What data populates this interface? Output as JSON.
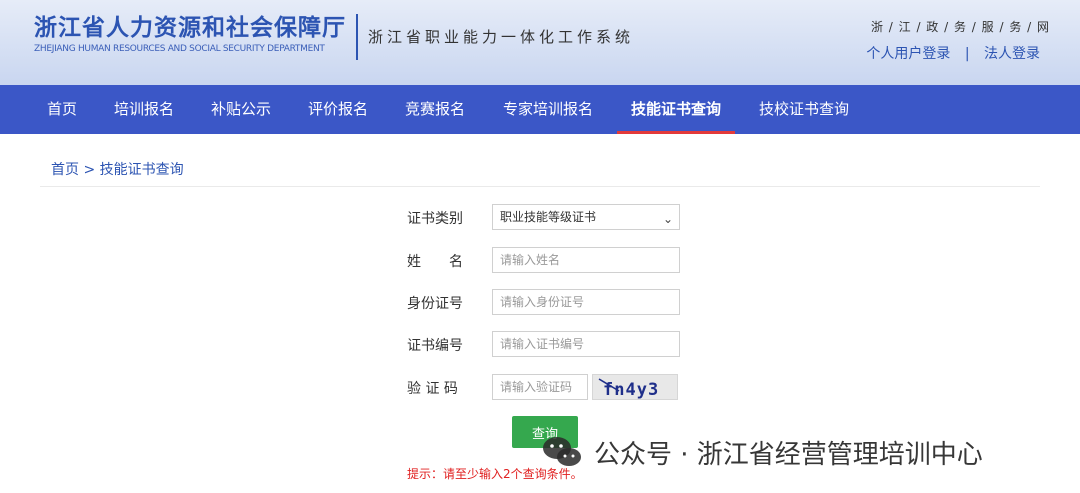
{
  "header": {
    "title_cn": "浙江省人力资源和社会保障厅",
    "title_en": "ZHEJIANG HUMAN RESOURCES AND SOCIAL SECURITY DEPARTMENT",
    "system_name": "浙江省职业能力一体化工作系统",
    "gov_link": "浙 / 江 / 政 / 务 / 服 / 务 / 网",
    "personal_login": "个人用户登录",
    "separator": "|",
    "legal_login": "法人登录"
  },
  "nav": {
    "items": [
      "首页",
      "培训报名",
      "补贴公示",
      "评价报名",
      "竞赛报名",
      "专家培训报名",
      "技能证书查询",
      "技校证书查询"
    ],
    "active": "技能证书查询"
  },
  "breadcrumb": "首页 > 技能证书查询",
  "form": {
    "cert_type_label": "证书类别",
    "cert_type_value": "职业技能等级证书",
    "name_label": "姓　　名",
    "name_placeholder": "请输入姓名",
    "id_label": "身份证号",
    "id_placeholder": "请输入身份证号",
    "cert_no_label": "证书编号",
    "cert_no_placeholder": "请输入证书编号",
    "captcha_label": "验 证 码",
    "captcha_placeholder": "请输入验证码",
    "captcha_text": "fn4y3",
    "query_button": "查询",
    "hint": "提示：请至少输入2个查询条件。"
  },
  "watermark": {
    "text": "公众号 · 浙江省经营管理培训中心"
  },
  "colors": {
    "brand": "#2c54b2",
    "nav_bg": "#3b57c7",
    "active_underline": "#e33a3a",
    "button": "#35a84e",
    "hint": "#e02020"
  }
}
